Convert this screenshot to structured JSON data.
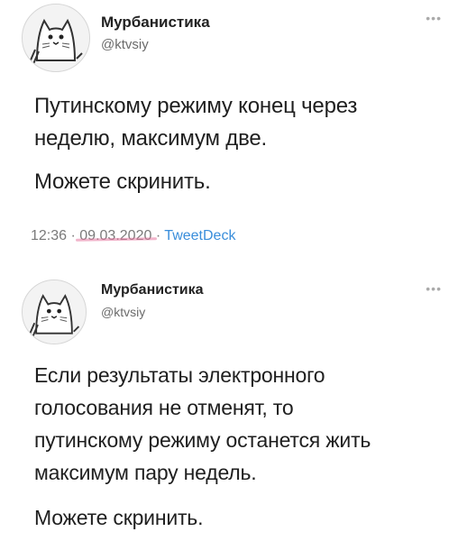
{
  "tweets": [
    {
      "author": {
        "name": "Мурбанистика",
        "handle": "@ktvsiy"
      },
      "more": "•••",
      "text": [
        "Путинскому режиму конец через",
        "неделю, максимум две."
      ],
      "text2": "Можете скринить.",
      "time": "12:36",
      "sep1": "·",
      "date": "09.03.2020",
      "sep2": "·",
      "source": "TweetDeck"
    },
    {
      "author": {
        "name": "Мурбанистика",
        "handle": "@ktvsiy"
      },
      "more": "•••",
      "text": [
        "Если результаты электронного",
        "голосования не отменят, то",
        "путинскому режиму останется жить",
        "максимум пару недель."
      ],
      "text2": "Можете скринить."
    }
  ]
}
